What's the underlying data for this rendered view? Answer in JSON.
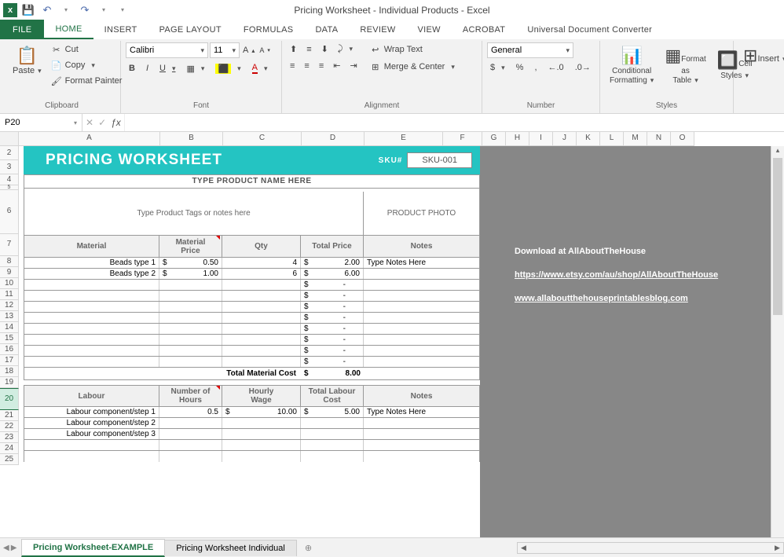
{
  "window": {
    "title": "Pricing Worksheet - Individual Products - Excel"
  },
  "tabs": {
    "file": "FILE",
    "home": "HOME",
    "insert": "INSERT",
    "pageLayout": "PAGE LAYOUT",
    "formulas": "FORMULAS",
    "data": "DATA",
    "review": "REVIEW",
    "view": "VIEW",
    "acrobat": "ACROBAT",
    "udc": "Universal Document Converter"
  },
  "ribbon": {
    "clipboard": {
      "label": "Clipboard",
      "paste": "Paste",
      "cut": "Cut",
      "copy": "Copy",
      "fmtPainter": "Format Painter"
    },
    "font": {
      "label": "Font",
      "name": "Calibri",
      "size": "11"
    },
    "alignment": {
      "label": "Alignment",
      "wrap": "Wrap Text",
      "merge": "Merge & Center"
    },
    "number": {
      "label": "Number",
      "format": "General"
    },
    "styles": {
      "label": "Styles",
      "cond": "Conditional Formatting",
      "fmtTable": "Format as Table",
      "cellStyles": "Cell Styles"
    },
    "cells": {
      "insert": "Insert"
    }
  },
  "nameBox": "P20",
  "cols": [
    "A",
    "B",
    "C",
    "D",
    "E",
    "F",
    "G",
    "H",
    "I",
    "J",
    "K",
    "L",
    "M",
    "N",
    "O"
  ],
  "rows": [
    "2",
    "3",
    "4",
    "5",
    "6",
    "7",
    "8",
    "9",
    "10",
    "11",
    "12",
    "13",
    "14",
    "15",
    "16",
    "17",
    "18",
    "19",
    "20",
    "21",
    "22",
    "23",
    "24",
    "25"
  ],
  "grayPanel": {
    "download": "Download at AllAboutTheHouse",
    "link1": "https://www.etsy.com/au/shop/AllAboutTheHouse",
    "link2": "www.allaboutthehouseprintablesblog.com"
  },
  "pw": {
    "title": "PRICING WORKSHEET",
    "skuLabel": "SKU#",
    "sku": "SKU-001",
    "prodName": "TYPE PRODUCT NAME HERE",
    "tags": "Type Product Tags or notes here",
    "photo": "PRODUCT PHOTO",
    "matHead": {
      "material": "Material",
      "price": "Material Price",
      "qty": "Qty",
      "total": "Total Price",
      "notes": "Notes"
    },
    "mat": [
      {
        "name": "Beads type 1",
        "dol": "$",
        "price": "0.50",
        "qty": "4",
        "tdol": "$",
        "total": "2.00",
        "notes": "Type Notes Here"
      },
      {
        "name": "Beads type 2",
        "dol": "$",
        "price": "1.00",
        "qty": "6",
        "tdol": "$",
        "total": "6.00",
        "notes": ""
      }
    ],
    "empty": {
      "dol": "$",
      "dash": "-"
    },
    "totalMatLabel": "Total Material Cost",
    "totalMatDol": "$",
    "totalMat": "8.00",
    "labHead": {
      "labour": "Labour",
      "hours": "Number of Hours",
      "wage": "Hourly Wage",
      "total": "Total Labour Cost",
      "notes": "Notes"
    },
    "lab": [
      {
        "name": "Labour component/step 1",
        "hours": "0.5",
        "wdol": "$",
        "wage": "10.00",
        "tdol": "$",
        "total": "5.00",
        "notes": "Type Notes Here"
      },
      {
        "name": "Labour component/step 2",
        "hours": "",
        "wdol": "",
        "wage": "",
        "tdol": "",
        "total": "",
        "notes": ""
      },
      {
        "name": "Labour component/step 3",
        "hours": "",
        "wdol": "",
        "wage": "",
        "tdol": "",
        "total": "",
        "notes": ""
      }
    ]
  },
  "sheets": {
    "s1": "Pricing Worksheet-EXAMPLE",
    "s2": "Pricing Worksheet Individual"
  }
}
